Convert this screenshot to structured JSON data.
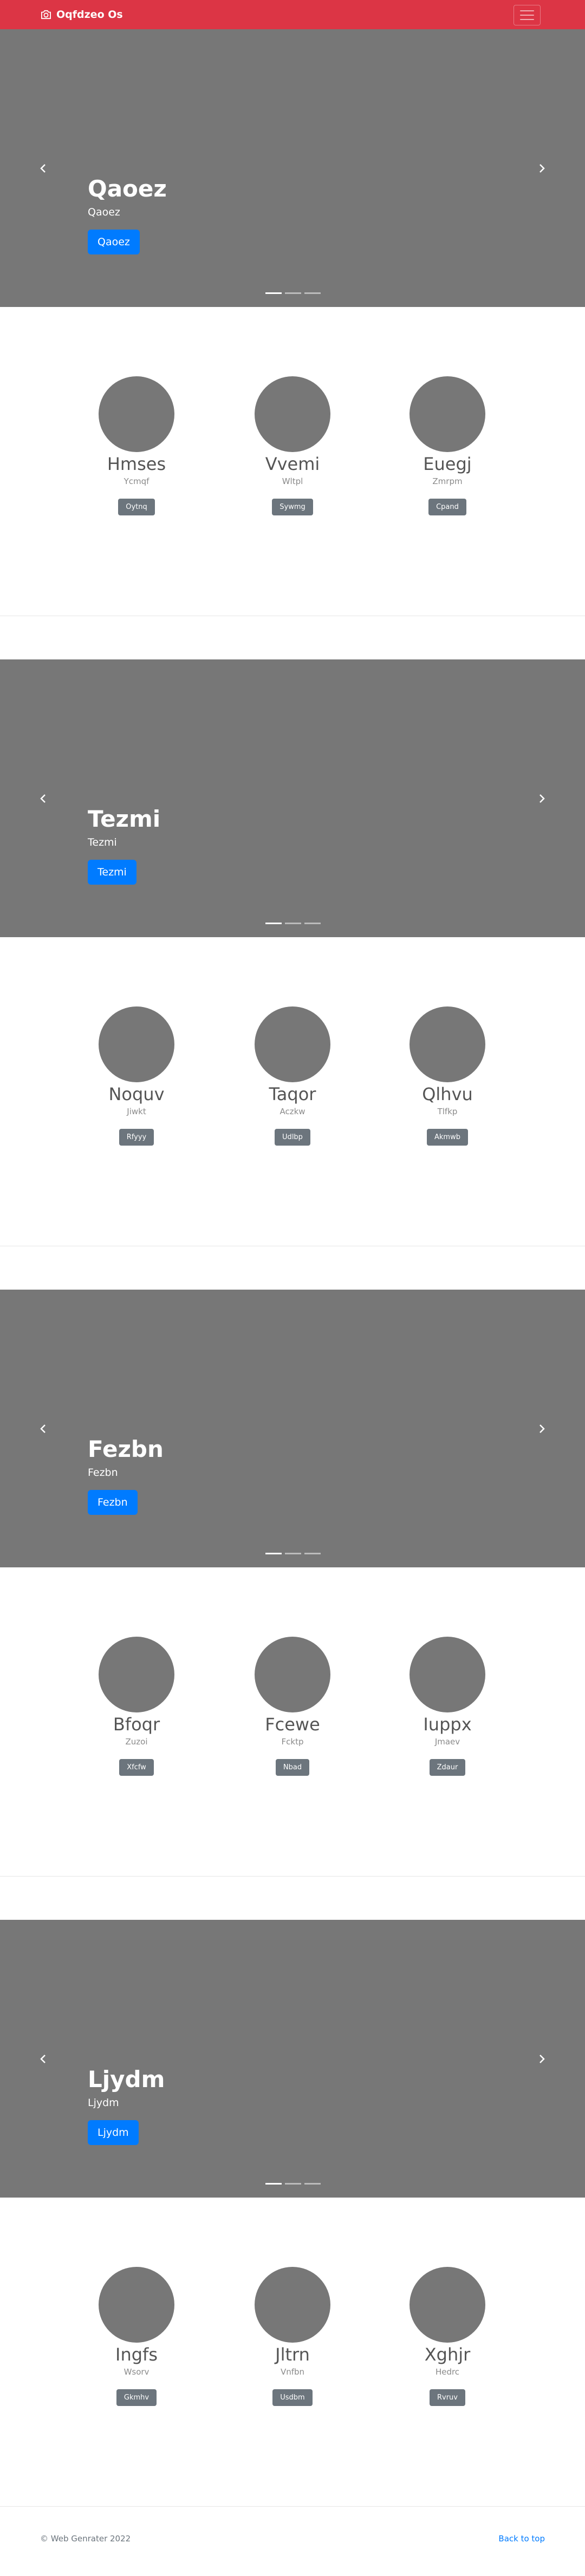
{
  "navbar": {
    "brand": "Oqfdzeo Os",
    "brand_icon": "camera-icon",
    "toggle_icon": "menu-icon"
  },
  "sections": [
    {
      "slide": {
        "title": "Qaoez",
        "subtitle": "Qaoez",
        "button": "Qaoez"
      },
      "people": [
        {
          "name": "Hmses",
          "sub": "Ycmqf",
          "button": "Oytnq"
        },
        {
          "name": "Vvemi",
          "sub": "Wltpl",
          "button": "Sywmg"
        },
        {
          "name": "Euegj",
          "sub": "Zmrpm",
          "button": "Cpand"
        }
      ]
    },
    {
      "slide": {
        "title": "Tezmi",
        "subtitle": "Tezmi",
        "button": "Tezmi"
      },
      "people": [
        {
          "name": "Noquv",
          "sub": "Jiwkt",
          "button": "Rfyyy"
        },
        {
          "name": "Taqor",
          "sub": "Aczkw",
          "button": "Udlbp"
        },
        {
          "name": "Qlhvu",
          "sub": "Tlfkp",
          "button": "Akmwb"
        }
      ]
    },
    {
      "slide": {
        "title": "Fezbn",
        "subtitle": "Fezbn",
        "button": "Fezbn"
      },
      "people": [
        {
          "name": "Bfoqr",
          "sub": "Zuzoi",
          "button": "Xfcfw"
        },
        {
          "name": "Fcewe",
          "sub": "Fcktp",
          "button": "Nbad"
        },
        {
          "name": "Iuppx",
          "sub": "Jmaev",
          "button": "Zdaur"
        }
      ]
    },
    {
      "slide": {
        "title": "Ljydm",
        "subtitle": "Ljydm",
        "button": "Ljydm"
      },
      "people": [
        {
          "name": "Ingfs",
          "sub": "Wsorv",
          "button": "Gkmhv"
        },
        {
          "name": "Jltrn",
          "sub": "Vnfbn",
          "button": "Usdbm"
        },
        {
          "name": "Xghjr",
          "sub": "Hedrc",
          "button": "Rvruv"
        }
      ]
    }
  ],
  "footer": {
    "copyright": "© Web Genrater 2022",
    "back_to_top": "Back to top"
  },
  "colors": {
    "navbar": "#dc3545",
    "slide_bg": "#777777",
    "primary": "#007bff",
    "secondary": "#6c757d"
  }
}
